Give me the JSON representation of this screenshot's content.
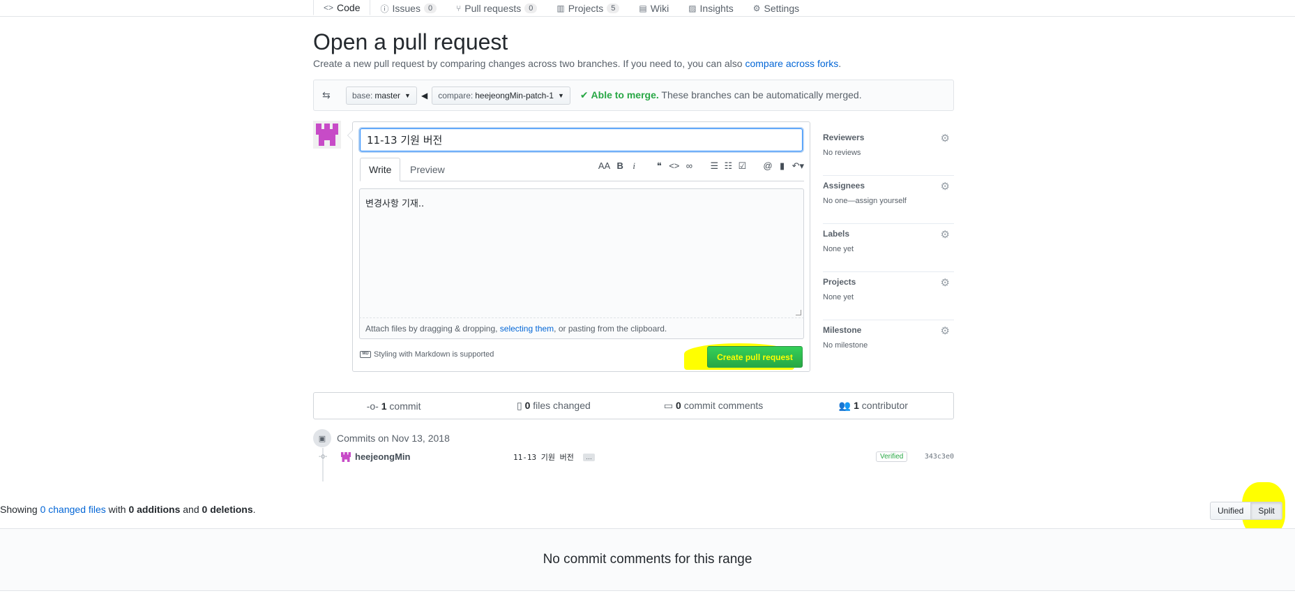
{
  "repo_nav": {
    "tabs": [
      {
        "label": "Code",
        "icon": "code-icon",
        "glyph": "<>",
        "counter": null
      },
      {
        "label": "Issues",
        "icon": "issue-icon",
        "glyph": "ⓘ",
        "counter": "0"
      },
      {
        "label": "Pull requests",
        "icon": "pull-request-icon",
        "glyph": "⑂",
        "counter": "0"
      },
      {
        "label": "Projects",
        "icon": "project-icon",
        "glyph": "▥",
        "counter": "5"
      },
      {
        "label": "Wiki",
        "icon": "book-icon",
        "glyph": "▤",
        "counter": null
      },
      {
        "label": "Insights",
        "icon": "graph-icon",
        "glyph": "▨",
        "counter": null
      },
      {
        "label": "Settings",
        "icon": "gear-icon",
        "glyph": "⚙",
        "counter": null
      }
    ]
  },
  "page": {
    "title": "Open a pull request",
    "subtitle_prefix": "Create a new pull request by comparing changes across two branches. If you need to, you can also ",
    "subtitle_link": "compare across forks",
    "subtitle_suffix": "."
  },
  "range": {
    "base_prefix": "base:",
    "base_branch": "master",
    "compare_prefix": "compare:",
    "compare_branch": "heejeongMin-patch-1",
    "merge_ok": "Able to merge.",
    "merge_text": "These branches can be automatically merged."
  },
  "compose": {
    "title_value": "11-13 기원 버전",
    "tab_write": "Write",
    "tab_preview": "Preview",
    "body_text": "변경사항 기재..",
    "attach_prefix": "Attach files by dragging & dropping, ",
    "attach_link": "selecting them",
    "attach_suffix": ", or pasting from the clipboard.",
    "markdown_note": "Styling with Markdown is supported",
    "markdown_icon_text": "MD",
    "create_button": "Create pull request",
    "toolbar": {
      "heading": "AA",
      "bold": "B",
      "italic": "i",
      "quote": "❝",
      "code": "<>",
      "link": "∞",
      "bullets": "☰",
      "numbered": "☷",
      "tasks": "☑",
      "mention": "@",
      "bookmark": "▮",
      "reply": "↶▾"
    }
  },
  "sidebar": {
    "items": [
      {
        "label": "Reviewers",
        "value": "No reviews"
      },
      {
        "label": "Assignees",
        "value": "No one—assign yourself"
      },
      {
        "label": "Labels",
        "value": "None yet"
      },
      {
        "label": "Projects",
        "value": "None yet"
      },
      {
        "label": "Milestone",
        "value": "No milestone"
      }
    ]
  },
  "numbers": {
    "commits_count": "1",
    "commits_label": "commit",
    "files_count": "0",
    "files_label": "files changed",
    "comments_count": "0",
    "comments_label": "commit comments",
    "contributors_count": "1",
    "contributors_label": "contributor"
  },
  "commits": {
    "heading": "Commits on Nov 13, 2018",
    "rows": [
      {
        "author": "heejeongMin",
        "message": "11-13 기원 버전",
        "ellipsis": "…",
        "verified": "Verified",
        "sha": "343c3e0"
      }
    ]
  },
  "toc": {
    "prefix": "Showing ",
    "changed_link": "0 changed files",
    "with": " with ",
    "additions": "0 additions",
    "and": " and ",
    "deletions": "0 deletions",
    "suffix": "."
  },
  "diff_view": {
    "unified": "Unified",
    "split": "Split"
  },
  "blankslate": "No commit comments for this range",
  "colors": {
    "accent": "#0366d6",
    "success": "#28a745",
    "highlight": "#ffff00",
    "avatar": "#c74bc7"
  }
}
